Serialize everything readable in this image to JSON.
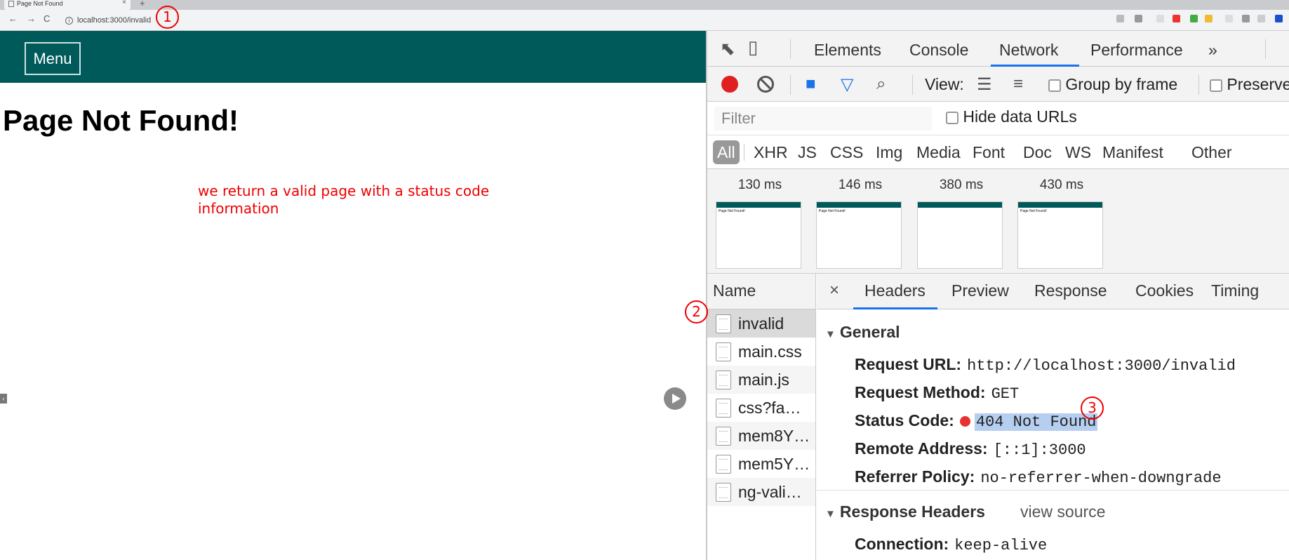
{
  "browser": {
    "tab_title": "Page Not Found",
    "tab_close": "×",
    "new_tab": "+",
    "url": "localhost:3000/invalid",
    "nav": {
      "back": "←",
      "forward": "→",
      "reload": "C"
    },
    "info_icon": "i"
  },
  "page": {
    "menu_label": "Menu",
    "title": "Page Not Found!",
    "annotation": "we return a valid page with a status code information",
    "collapse_glyph": "‹"
  },
  "devtools": {
    "tabs": [
      "Elements",
      "Console",
      "Network",
      "Performance",
      "»"
    ],
    "active_tab": "Network",
    "view_label": "View:",
    "group_by_frame": "Group by frame",
    "preserve_log": "Preserve",
    "filter_placeholder": "Filter",
    "hide_data_urls": "Hide data URLs",
    "types": [
      "All",
      "XHR",
      "JS",
      "CSS",
      "Img",
      "Media",
      "Font",
      "Doc",
      "WS",
      "Manifest",
      "Other"
    ],
    "filmstrip": [
      {
        "time": "130 ms",
        "thumb_text": "Page Not Found!",
        "has_header": true
      },
      {
        "time": "146 ms",
        "thumb_text": "Page Not Found!",
        "has_header": true
      },
      {
        "time": "380 ms",
        "thumb_text": "",
        "has_header": true
      },
      {
        "time": "430 ms",
        "thumb_text": "Page Not Found!",
        "has_header": true
      }
    ],
    "name_header": "Name",
    "requests": [
      "invalid",
      "main.css",
      "main.js",
      "css?fa…",
      "mem8Y…",
      "mem5Y…",
      "ng-vali…"
    ],
    "detail_close": "×",
    "detail_tabs": [
      "Headers",
      "Preview",
      "Response",
      "Cookies",
      "Timing"
    ],
    "general": {
      "title": "General",
      "request_url_label": "Request URL:",
      "request_url": "http://localhost:3000/invalid",
      "request_method_label": "Request Method:",
      "request_method": "GET",
      "status_code_label": "Status Code:",
      "status_code": "404 Not Found",
      "remote_address_label": "Remote Address:",
      "remote_address": "[::1]:3000",
      "referrer_policy_label": "Referrer Policy:",
      "referrer_policy": "no-referrer-when-downgrade"
    },
    "response_headers": {
      "title": "Response Headers",
      "view_source": "view source",
      "connection_label": "Connection:",
      "connection": "keep-alive"
    }
  },
  "annotations": [
    "1",
    "2",
    "3"
  ],
  "colors": {
    "page_header": "#005a5a",
    "annotation_red": "#ee0000",
    "record_red": "#e02020",
    "active_tab_blue": "#1a73e8",
    "selection_highlight": "#b6cff1"
  }
}
